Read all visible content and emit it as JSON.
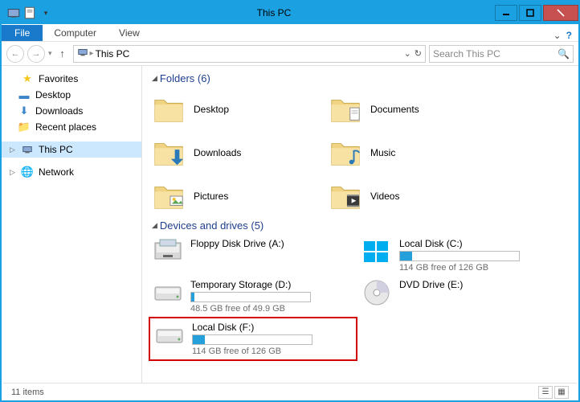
{
  "window": {
    "title": "This PC"
  },
  "ribbon": {
    "file": "File",
    "tabs": [
      "Computer",
      "View"
    ]
  },
  "address": {
    "location": "This PC",
    "search_placeholder": "Search This PC"
  },
  "nav": {
    "favorites": {
      "label": "Favorites",
      "items": [
        "Desktop",
        "Downloads",
        "Recent places"
      ]
    },
    "thispc": {
      "label": "This PC"
    },
    "network": {
      "label": "Network"
    }
  },
  "sections": {
    "folders": {
      "title": "Folders (6)",
      "items": [
        "Desktop",
        "Documents",
        "Downloads",
        "Music",
        "Pictures",
        "Videos"
      ]
    },
    "drives": {
      "title": "Devices and drives (5)",
      "items": [
        {
          "name": "Floppy Disk Drive (A:)",
          "type": "floppy",
          "bar": false
        },
        {
          "name": "Local Disk (C:)",
          "type": "os",
          "bar": true,
          "fill_pct": 10,
          "free": "114 GB free of 126 GB"
        },
        {
          "name": "Temporary Storage (D:)",
          "type": "hdd",
          "bar": true,
          "fill_pct": 3,
          "free": "48.5 GB free of 49.9 GB"
        },
        {
          "name": "DVD Drive (E:)",
          "type": "dvd",
          "bar": false
        },
        {
          "name": "Local Disk (F:)",
          "type": "hdd",
          "bar": true,
          "fill_pct": 10,
          "free": "114 GB free of 126 GB",
          "highlighted": true
        }
      ]
    }
  },
  "status": {
    "count": "11 items"
  }
}
